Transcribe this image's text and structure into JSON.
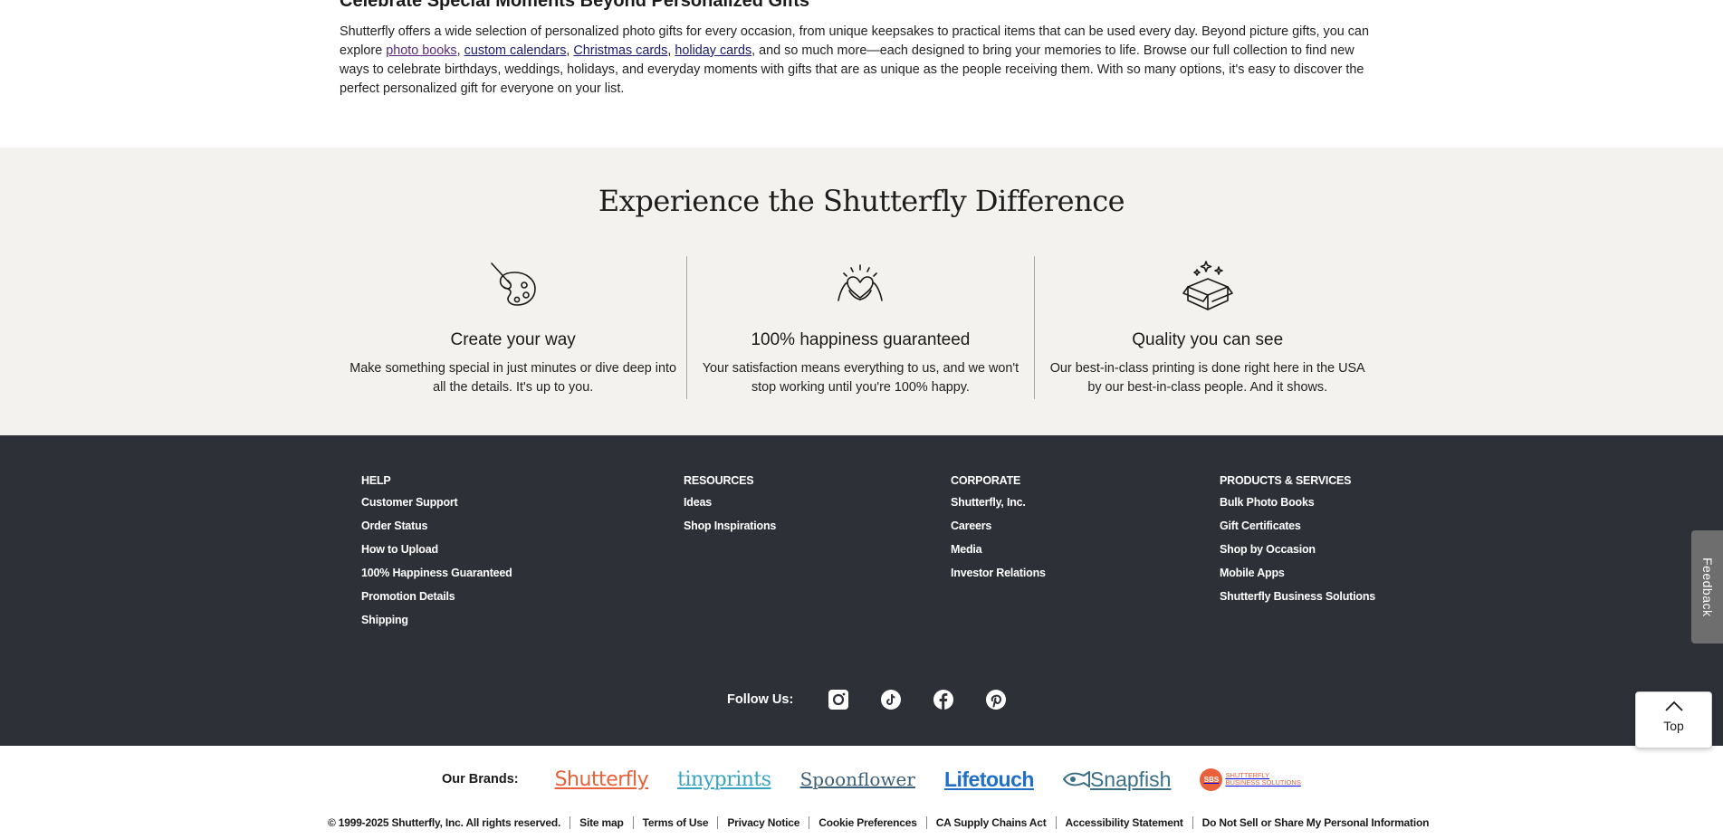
{
  "intro": {
    "title": "Celebrate Special Moments Beyond Personalized Gifts",
    "text_1": "Shutterfly offers a wide selection of personalized photo gifts for every occasion, from unique keepsakes to practical items that can be used every day. Beyond picture gifts, you can explore ",
    "link_photo_books": "photo books",
    "sep_1": ", ",
    "link_custom_calendars": "custom calendars",
    "sep_2": ", ",
    "link_christmas_cards": "Christmas cards",
    "sep_3": ", ",
    "link_holiday_cards": "holiday cards",
    "text_2": ", and so much more—each designed to bring your memories to life. Browse our full collection to find new ways to celebrate birthdays, weddings, holidays, and everyday moments with gifts that are as unique as the people receiving them. With so many options, it's easy to discover the perfect personalized gift for everyone on your list."
  },
  "difference": {
    "title": "Experience the Shutterfly Difference",
    "features": [
      {
        "icon": "palette-icon",
        "title": "Create your way",
        "text": "Make something special in just minutes or dive deep into all the details. It's up to you."
      },
      {
        "icon": "heart-hands-icon",
        "title": "100% happiness guaranteed",
        "text": "Your satisfaction means everything to us, and we won't stop working until you're 100% happy."
      },
      {
        "icon": "sparkle-box-icon",
        "title": "Quality you can see",
        "text": "Our best-in-class printing is done right here in the USA by our best-in-class people. And it shows."
      }
    ]
  },
  "footer": {
    "help": {
      "title": "HELP",
      "links": [
        "Customer Support",
        "Order Status",
        "How to Upload",
        "100% Happiness Guaranteed",
        "Promotion Details",
        "Shipping"
      ]
    },
    "resources": {
      "title": "RESOURCES",
      "links": [
        "Ideas",
        "Shop Inspirations"
      ]
    },
    "corporate": {
      "title": "CORPORATE",
      "links": [
        "Shutterfly, Inc.",
        "Careers",
        "Media",
        "Investor Relations"
      ]
    },
    "products": {
      "title": "PRODUCTS & SERVICES",
      "links": [
        "Bulk Photo Books",
        "Gift Certificates",
        "Shop by Occasion",
        "Mobile Apps",
        "Shutterfly Business Solutions"
      ]
    },
    "follow_label": "Follow Us:",
    "social_icons": [
      "instagram-icon",
      "tiktok-icon",
      "facebook-icon",
      "pinterest-icon"
    ]
  },
  "brands": {
    "label": "Our Brands:",
    "shutterfly": "Shutterfly",
    "tinyprints": "tinyprints",
    "spoonflower": "Spoonflower",
    "lifetouch": "Lifetouch",
    "snapfish": "Snapfish",
    "sbs_badge": "SBS",
    "sbs_line1": "SHUTTERFLY",
    "sbs_line2": "BUSINESS SOLUTIONS"
  },
  "legal": {
    "copyright": "© 1999-2025 Shutterfly, Inc. All rights reserved.",
    "links": [
      "Site map",
      "Terms of Use",
      "Privacy Notice",
      "Cookie Preferences",
      "CA Supply Chains Act",
      "Accessibility Statement",
      "Do Not Sell or Share My Personal Information"
    ]
  },
  "widgets": {
    "feedback": "Feedback",
    "top": "Top"
  },
  "colors": {
    "difference_bg": "#f3f2ef",
    "footer_bg": "#2e3038",
    "brand_orange": "#e8613a",
    "link_navy": "#1a1a6e"
  }
}
